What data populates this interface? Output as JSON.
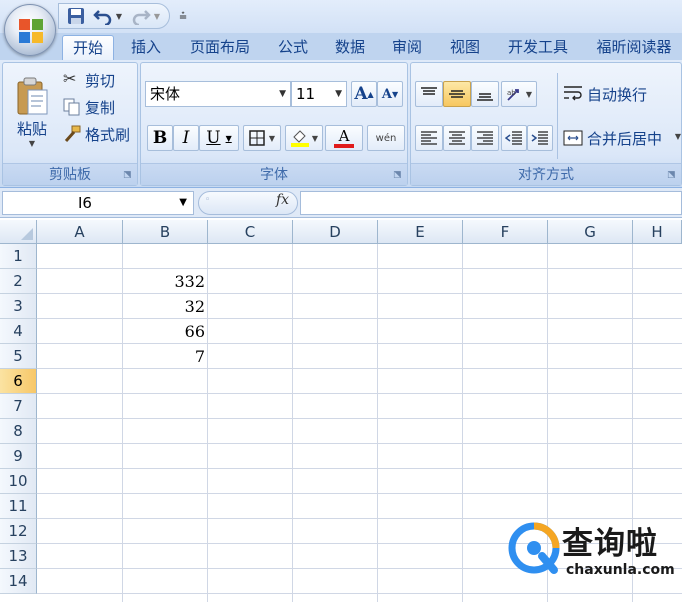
{
  "quick_access": {
    "icons": [
      "office-button",
      "save-icon",
      "undo-icon",
      "redo-icon",
      "customize-qat-icon"
    ]
  },
  "tabs": [
    {
      "label": "开始",
      "active": true
    },
    {
      "label": "插入"
    },
    {
      "label": "页面布局"
    },
    {
      "label": "公式"
    },
    {
      "label": "数据"
    },
    {
      "label": "审阅"
    },
    {
      "label": "视图"
    },
    {
      "label": "开发工具"
    },
    {
      "label": "福昕阅读器"
    }
  ],
  "ribbon": {
    "clipboard": {
      "group_label": "剪贴板",
      "paste_label": "粘贴",
      "cut_label": "剪切",
      "copy_label": "复制",
      "format_painter_label": "格式刷"
    },
    "font": {
      "group_label": "字体",
      "font_name": "宋体",
      "font_size": "11",
      "bold": "B",
      "italic": "I",
      "underline": "U",
      "grow_font": "A",
      "shrink_font": "A",
      "font_color_letter": "A",
      "phonetic": "wén"
    },
    "alignment": {
      "group_label": "对齐方式",
      "wrap_text_label": "自动换行",
      "merge_center_label": "合并后居中"
    }
  },
  "formula_bar": {
    "name_box": "I6",
    "fx_label": "fx",
    "formula": ""
  },
  "grid": {
    "columns": [
      "A",
      "B",
      "C",
      "D",
      "E",
      "F",
      "G",
      "H"
    ],
    "rows": [
      "1",
      "2",
      "3",
      "4",
      "5",
      "6",
      "7",
      "8",
      "9",
      "10",
      "11",
      "12",
      "13",
      "14"
    ],
    "selected_row": "6",
    "cells": {
      "B2": "332",
      "B3": "32",
      "B4": "66",
      "B5": "7"
    }
  },
  "watermark": {
    "title": "查询啦",
    "url": "chaxunla.com"
  },
  "colors": {
    "ribbon_bg": "#d4e2f6",
    "tab_text": "#15428b",
    "selected_header": "#f7c768",
    "gridline": "#d0d7e5"
  }
}
